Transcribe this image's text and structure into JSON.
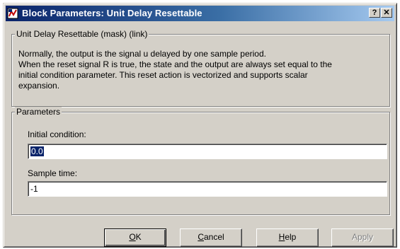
{
  "window": {
    "title": "Block Parameters: Unit Delay Resettable",
    "help_glyph": "?",
    "close_glyph": "✕"
  },
  "description": {
    "legend": "Unit Delay Resettable (mask) (link)",
    "lines": [
      "Normally, the output is the signal u delayed by one sample period.",
      "When the reset signal R is true, the state and the output are always set equal to the",
      "initial condition parameter.  This reset action is vectorized and supports scalar",
      "expansion."
    ]
  },
  "parameters": {
    "legend": "Parameters",
    "initial_condition": {
      "label": "Initial condition:",
      "value": "0.0"
    },
    "sample_time": {
      "label": "Sample time:",
      "value": "-1"
    }
  },
  "buttons": {
    "ok": {
      "mnemonic": "O",
      "rest": "K"
    },
    "cancel": {
      "mnemonic": "C",
      "rest": "ancel"
    },
    "help": {
      "mnemonic": "H",
      "rest": "elp"
    },
    "apply": {
      "label": "Apply"
    }
  },
  "colors": {
    "title_bar_start": "#0a246a",
    "title_bar_end": "#a6caf0",
    "face": "#d4d0c8",
    "selection": "#0a246a"
  }
}
